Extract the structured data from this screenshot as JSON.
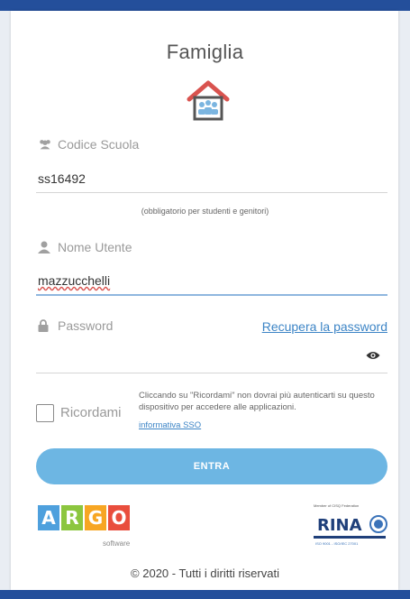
{
  "header": {
    "title": "Famiglia"
  },
  "school_code": {
    "label": "Codice Scuola",
    "value": "ss16492",
    "hint": "(obbligatorio per studenti e genitori)"
  },
  "username": {
    "label": "Nome Utente",
    "value": "mazzucchelli"
  },
  "password": {
    "label": "Password",
    "recover_link": "Recupera la password"
  },
  "remember": {
    "label": "Ricordami",
    "note": "Cliccando su \"Ricordami\" non dovrai più autenticarti su questo dispositivo per accedere alle applicazioni.",
    "link": "informativa SSO"
  },
  "submit": {
    "label": "ENTRA"
  },
  "brand": {
    "letters": [
      "A",
      "R",
      "G",
      "O"
    ],
    "subtitle": "software"
  },
  "cert": {
    "top_text": "Member of CISQ Federation",
    "name": "RINA",
    "bottom_text": "ISO 9001 - ISO/IEC 27001"
  },
  "footer": {
    "copyright": "© 2020 - Tutti i diritti riservati"
  },
  "colors": {
    "primary_bar": "#244f9b",
    "button": "#6db6e3",
    "link": "#3d85c6",
    "argo": [
      "#4ea0dd",
      "#8cc63f",
      "#f7a623",
      "#e94e3d"
    ]
  },
  "icons": [
    "house-family-icon",
    "users-icon",
    "user-icon",
    "lock-icon",
    "eye-icon"
  ]
}
